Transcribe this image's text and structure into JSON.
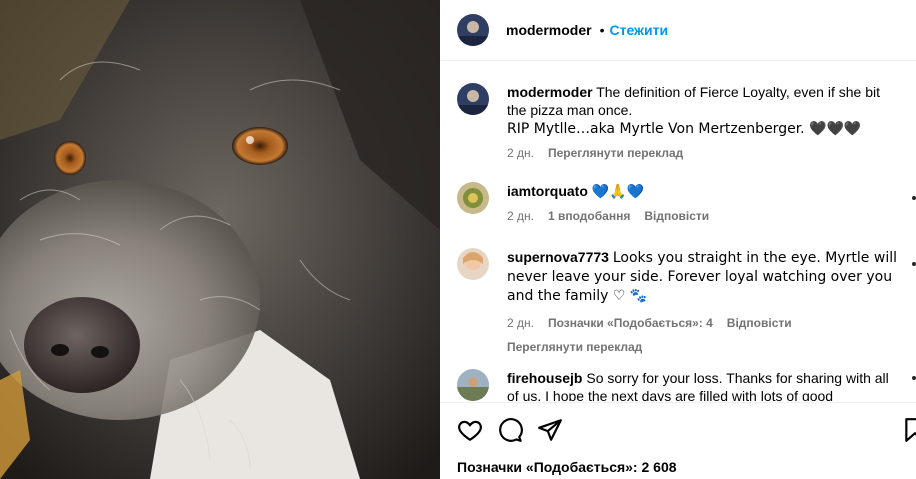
{
  "post": {
    "author": "modermoder",
    "dot": "•",
    "follow_label": "Стежити"
  },
  "caption": {
    "username": "modermoder",
    "text_line1": "The definition of Fierce Loyalty, even if she bit the pizza man once.",
    "text_line2": "RIP Mytlle…aka Myrtle Von Mertzenberger. 🖤🖤🖤",
    "time": "2 дн.",
    "translate_label": "Переглянути переклад"
  },
  "comments": [
    {
      "username": "iamtorquato",
      "text": "💙🙏💙",
      "time": "2 дн.",
      "likes": "1 вподобання",
      "reply_label": "Відповісти"
    },
    {
      "username": "supernova7773",
      "text": "Looks you straight in the eye. Myrtle will never leave your side. Forever loyal watching over you and the family ♡ 🐾",
      "time": "2 дн.",
      "likes": "Позначки «Подобається»: 4",
      "reply_label": "Відповісти",
      "translate_label": "Переглянути переклад"
    },
    {
      "username": "firehousejb",
      "text": "So sorry for your loss. Thanks for sharing with all of us. I hope the next days are filled with lots of good memories"
    }
  ],
  "footer": {
    "likes_text": "Позначки «Подобається»: 2 608"
  },
  "icons": {
    "like": "heart-icon",
    "comment": "comment-icon",
    "share": "share-icon",
    "save": "bookmark-icon"
  },
  "colors": {
    "accent": "#0095f6",
    "secondary_text": "#737373",
    "divider": "#efefef"
  }
}
